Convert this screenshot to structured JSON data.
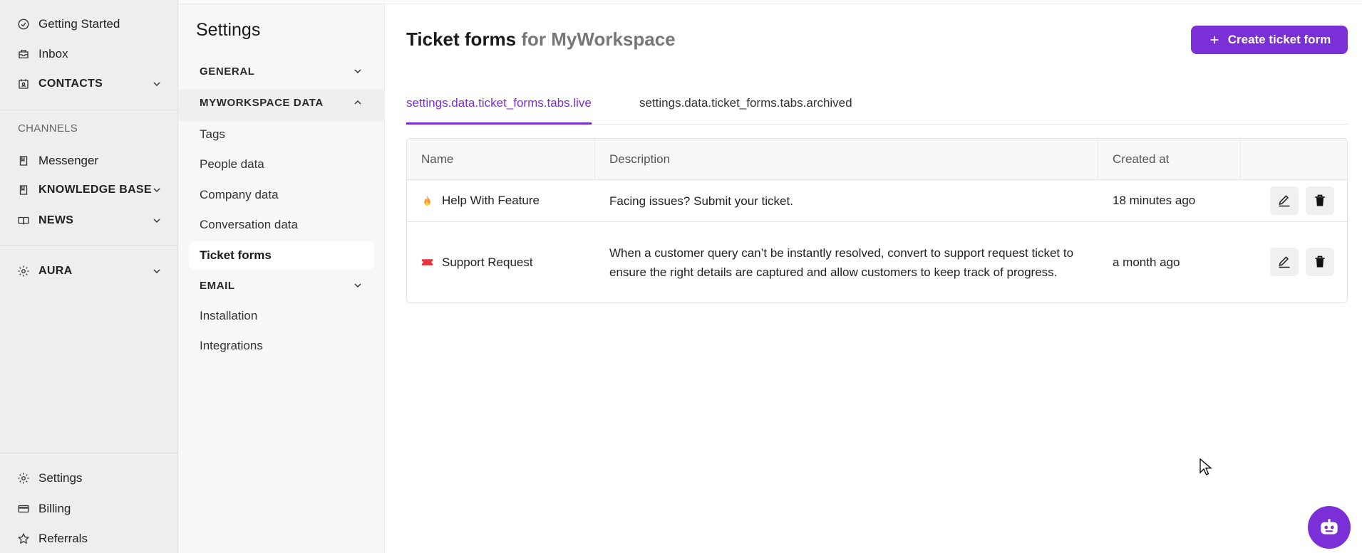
{
  "nav": {
    "items": [
      {
        "label": "Getting Started",
        "icon": "check-circle-icon"
      },
      {
        "label": "Inbox",
        "icon": "inbox-icon"
      },
      {
        "label": "CONTACTS",
        "icon": "contacts-icon"
      },
      {
        "label": "CHANNELS"
      },
      {
        "label": "Messenger",
        "icon": "book-icon"
      },
      {
        "label": "KNOWLEDGE BASE",
        "icon": "book-icon"
      },
      {
        "label": "NEWS",
        "icon": "news-icon"
      },
      {
        "label": "AURA",
        "icon": "gear-icon"
      }
    ],
    "bottom": [
      {
        "label": "Settings",
        "icon": "gear-icon"
      },
      {
        "label": "Billing",
        "icon": "credit-card-icon"
      },
      {
        "label": "Referrals",
        "icon": "star-icon"
      }
    ]
  },
  "settings": {
    "title": "Settings",
    "groups": [
      {
        "label": "GENERAL"
      },
      {
        "label": "MYWORKSPACE DATA"
      },
      {
        "label": "EMAIL"
      }
    ],
    "data_items": [
      "Tags",
      "People data",
      "Company data",
      "Conversation data",
      "Ticket forms"
    ],
    "email_items": [
      "Installation",
      "Integrations"
    ]
  },
  "main": {
    "title": "Ticket forms",
    "workspace": "for MyWorkspace",
    "create_label": "Create ticket form",
    "tabs": [
      {
        "label": "settings.data.ticket_forms.tabs.live",
        "active": true
      },
      {
        "label": "settings.data.ticket_forms.tabs.archived",
        "active": false
      }
    ],
    "columns": [
      "Name",
      "Description",
      "Created at"
    ],
    "rows": [
      {
        "name": "Help With Feature",
        "icon": "fire-icon",
        "description": "Facing issues? Submit your ticket.",
        "created": "18 minutes ago"
      },
      {
        "name": "Support Request",
        "icon": "ticket-icon",
        "description": "When a customer query can’t be instantly resolved, convert to support request ticket to ensure the right details are captured and allow customers to keep track of progress.",
        "created": "a month ago"
      }
    ]
  },
  "colors": {
    "accent": "#7b2fd6",
    "nav_bg": "#eeeeee",
    "sub_bg": "#f7f7f7"
  }
}
